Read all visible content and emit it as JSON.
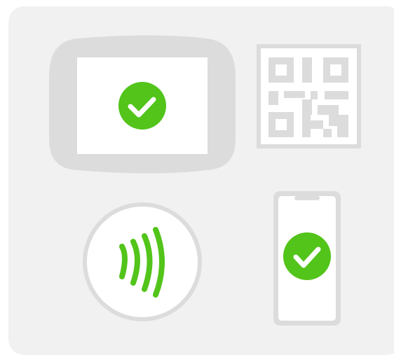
{
  "illustration": {
    "colors": {
      "panel": "#f1f1f1",
      "device_gray": "#dcdcdc",
      "screen": "#ffffff",
      "accent_green": "#52c41a",
      "check_white": "#ffffff"
    },
    "icons": {
      "terminal_status": "check-circle-icon",
      "phone_status": "check-circle-icon",
      "contactless": "contactless-waves-icon",
      "code": "qr-code-icon"
    }
  }
}
